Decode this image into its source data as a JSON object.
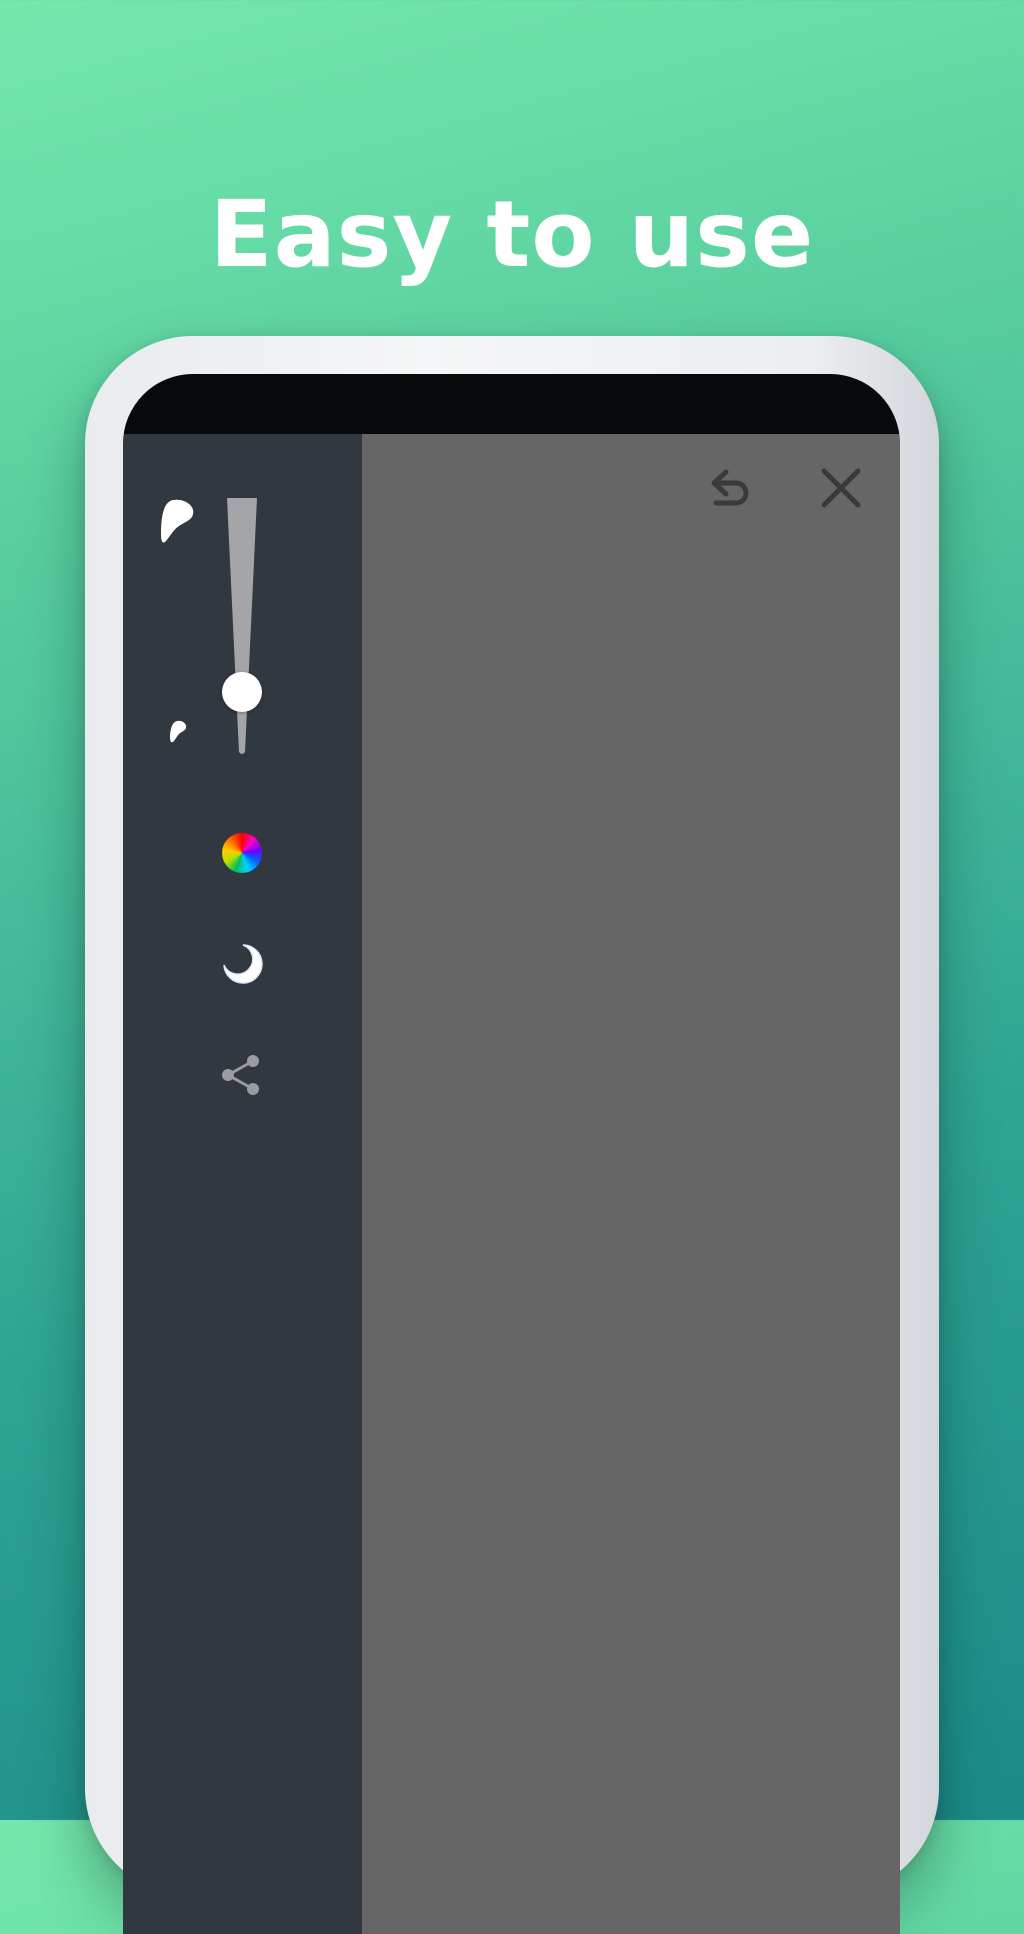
{
  "headline": "Easy to use",
  "toolbar": {
    "undo_icon": "undo-icon",
    "close_icon": "close-icon"
  },
  "sidebar": {
    "brush_size_large_icon": "large-brush-drop-icon",
    "brush_size_small_icon": "small-brush-drop-icon",
    "brush_size_level": 0.2,
    "color_picker_icon": "color-wheel-icon",
    "night_mode_icon": "moon-icon",
    "share_icon": "share-icon"
  },
  "colors": {
    "background_top": "#74e8ab",
    "background_bottom": "#1a8b88",
    "sidebar": "#323840",
    "canvas": "#666666",
    "status_bar": "#08090b",
    "icon_dark": "#3a3a3a",
    "slider_track": "#a3a5a8"
  }
}
